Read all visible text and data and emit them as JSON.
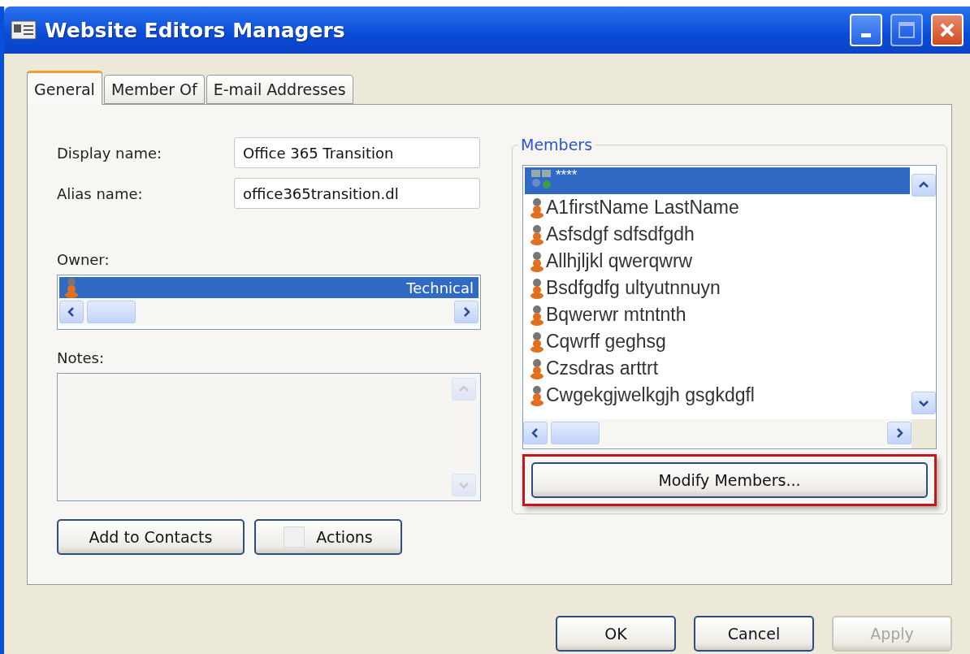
{
  "window": {
    "title": "Website Editors Managers"
  },
  "tabs": [
    {
      "label": "General",
      "selected": true
    },
    {
      "label": "Member Of",
      "selected": false
    },
    {
      "label": "E-mail Addresses",
      "selected": false
    }
  ],
  "fields": [
    {
      "label": "Display name:",
      "value": "Office 365 Transition"
    },
    {
      "label": "Alias name:",
      "value": "office365transition.dl"
    }
  ],
  "owner": {
    "label": "Owner:",
    "items": [
      {
        "text": "Technical",
        "selected": true
      }
    ]
  },
  "notes": {
    "label": "Notes:"
  },
  "left_buttons": [
    {
      "label": "Add to Contacts",
      "kind": "plain"
    },
    {
      "label": "Actions",
      "kind": "checkbox"
    }
  ],
  "members": {
    "label": "Members",
    "items": [
      {
        "name": "****",
        "kind": "group",
        "selected": true
      },
      {
        "name": "A1firstName LastName",
        "kind": "user",
        "selected": false
      },
      {
        "name": "Asfsdgf  sdfsdfgdh",
        "kind": "user",
        "selected": false
      },
      {
        "name": "Allhjljkl qwerqwrw",
        "kind": "user",
        "selected": false
      },
      {
        "name": "Bsdfgdfg ultyutnnuyn",
        "kind": "user",
        "selected": false
      },
      {
        "name": "Bqwerwr mtntnth",
        "kind": "user",
        "selected": false
      },
      {
        "name": "Cqwrff geghsg",
        "kind": "user",
        "selected": false
      },
      {
        "name": "Czsdras arttrt",
        "kind": "user",
        "selected": false
      },
      {
        "name": "Cwgekgjwelkgjh gsgkdgfl",
        "kind": "user",
        "selected": false
      }
    ],
    "modify_button": {
      "label": "Modify Members...",
      "highlighted": true
    }
  },
  "footer_buttons": [
    {
      "label": "OK",
      "disabled": false
    },
    {
      "label": "Cancel",
      "disabled": false
    },
    {
      "label": "Apply",
      "disabled": true
    }
  ]
}
